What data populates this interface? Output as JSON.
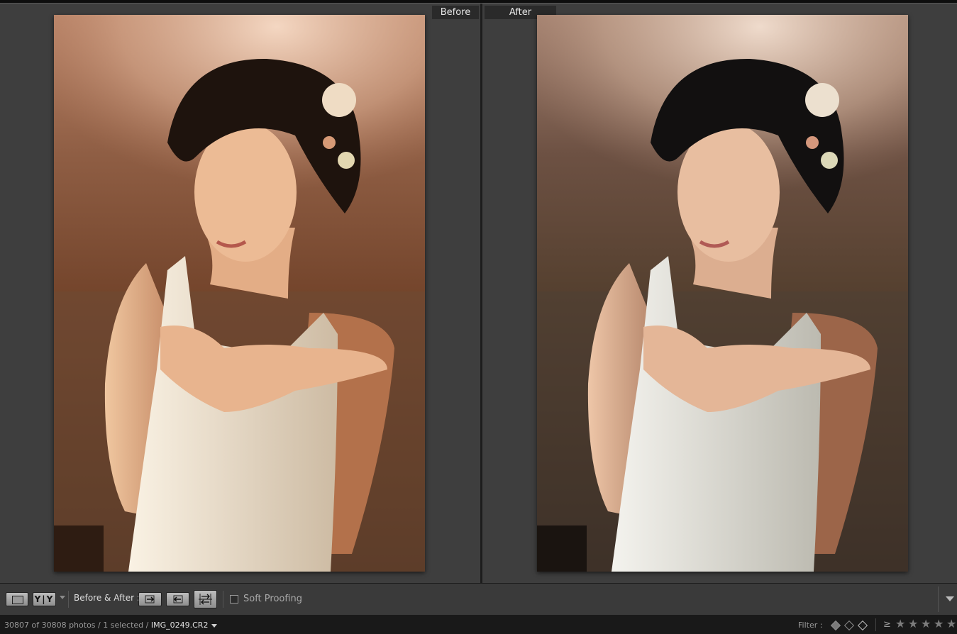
{
  "compare": {
    "before_label": "Before",
    "after_label": "After",
    "left_image": "bride portrait - original warm",
    "right_image": "bride portrait - edited"
  },
  "toolbar": {
    "view_mode_icons": [
      "loupe-view-icon",
      "before-after-yy-icon"
    ],
    "yy_label": "Y|Y",
    "before_after_label": "Before & After :",
    "copy_buttons": [
      "copy-before-to-after-icon",
      "copy-after-to-before-icon",
      "swap-before-after-icon"
    ],
    "soft_proofing_label": "Soft Proofing",
    "soft_proofing_checked": false
  },
  "status": {
    "count_text": "30807 of 30808 photos / 1 selected /",
    "filename": "IMG_0249.CR2",
    "filter_label": "Filter :",
    "rating_operator": "≥",
    "rating_min": 5
  },
  "colors": {
    "panel_bg": "#3d3d3d",
    "status_bg": "#191919",
    "label_bg": "#2a2a2a"
  }
}
